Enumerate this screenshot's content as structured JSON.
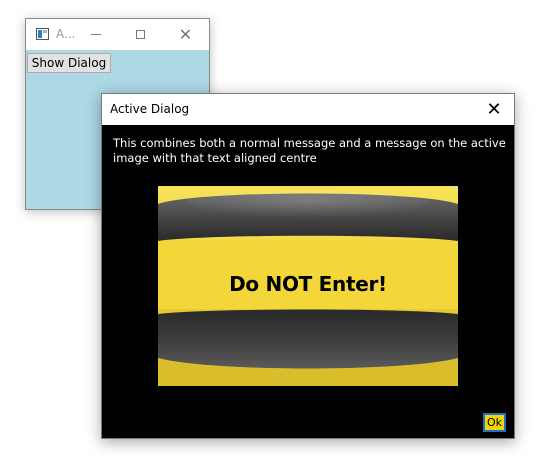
{
  "background_window": {
    "title": "A...",
    "show_dialog_label": "Show Dialog",
    "background_color": "#add8e6"
  },
  "dialog": {
    "title": "Active Dialog",
    "message": "This combines both a normal message and a message on the active image with that text aligned centre",
    "image_text": "Do NOT Enter!",
    "ok_label": "Ok",
    "colors": {
      "background": "#000000",
      "stripe_yellow": "#f2d63a",
      "stripe_dark": "#3a3a3a",
      "ok_button": "#f2d600",
      "ok_border": "#1e6fc7"
    }
  },
  "icons": {
    "app": "app-window-icon",
    "minimize": "minimize-icon",
    "maximize": "maximize-icon",
    "close": "close-icon"
  }
}
